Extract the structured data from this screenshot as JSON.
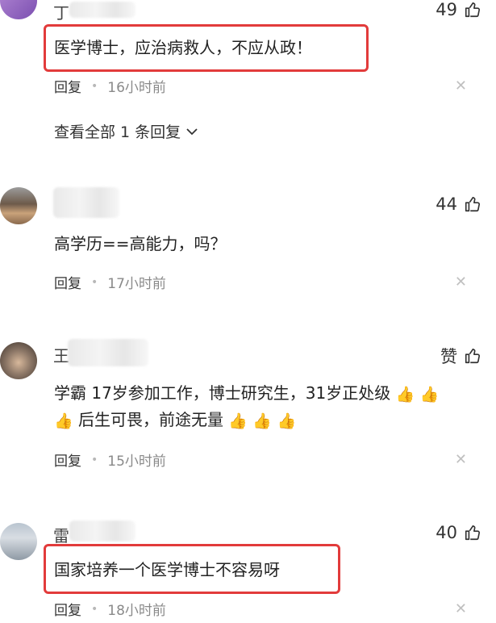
{
  "comments": [
    {
      "name_char": "丁",
      "likes": "49",
      "text": "医学博士，应治病救人，不应从政！",
      "reply_label": "回复",
      "time": "16小时前",
      "view_all": "查看全部 1 条回复"
    },
    {
      "name_char": "",
      "likes": "44",
      "text": "高学历==高能力，吗？",
      "reply_label": "回复",
      "time": "17小时前"
    },
    {
      "name_char": "王",
      "likes": "赞",
      "text_line1": "学霸 17岁参加工作，博士研究生，31岁正处级",
      "text_line2": "后生可畏，前途无量",
      "reply_label": "回复",
      "time": "15小时前"
    },
    {
      "name_char": "雷",
      "likes": "40",
      "text": "国家培养一个医学博士不容易呀",
      "reply_label": "回复",
      "time": "18小时前"
    }
  ],
  "icons": {
    "like": "thumbs-up-icon",
    "close": "close-icon",
    "chevron": "chevron-down-icon",
    "emoji": "thumbs-up-emoji"
  },
  "colors": {
    "highlight": "#e23b3b",
    "meta_gray": "#8a8a8a"
  }
}
